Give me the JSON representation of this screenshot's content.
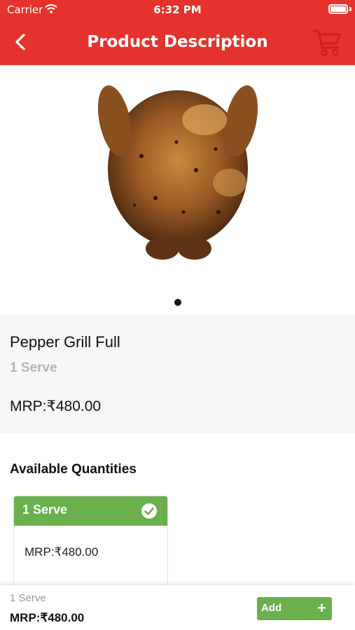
{
  "status_bar": {
    "carrier": "Carrier",
    "time": "6:32 PM",
    "wifi_icon": "wifi-icon",
    "battery_icon": "battery-icon",
    "battery_level": 1.0
  },
  "header": {
    "title": "Product Description",
    "back_icon": "chevron-left-icon",
    "cart_icon": "cart-icon",
    "background_color": "#e6322c"
  },
  "product": {
    "image": "roast-chicken-image",
    "carousel": {
      "dot_count": 1,
      "active_index": 0
    },
    "name": "Pepper Grill Full",
    "serve": "1 Serve",
    "mrp": "MRP:₹480.00"
  },
  "quantities": {
    "heading": "Available Quantities",
    "options": [
      {
        "label": "1 Serve",
        "mrp": "MRP:₹480.00",
        "selected": true,
        "icon": "check-circle-icon"
      }
    ],
    "accent_color": "#6ab04c"
  },
  "bottom_bar": {
    "serve": "1 Serve",
    "mrp": "MRP:₹480.00",
    "add_label": "Add",
    "add_icon": "plus-icon",
    "add_glyph": "+"
  }
}
